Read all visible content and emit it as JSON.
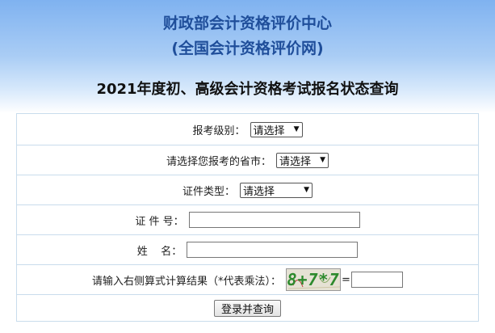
{
  "header": {
    "title_line1": "财政部会计资格评价中心",
    "title_line2": "(全国会计资格评价网)",
    "subtitle": "2021年度初、高级会计资格考试报名状态查询"
  },
  "form": {
    "level": {
      "label": "报考级别：",
      "selected": "请选择"
    },
    "province": {
      "label": "请选择您报考的省市：",
      "selected": "请选择"
    },
    "id_type": {
      "label": "证件类型：",
      "selected": "请选择"
    },
    "id_number": {
      "label": "证 件 号：",
      "value": ""
    },
    "name": {
      "label": "姓    名：",
      "value": ""
    },
    "captcha": {
      "label": "请输入右侧算式计算结果（*代表乘法）：",
      "expression": "8+7*7",
      "equals": "=",
      "value": ""
    },
    "submit_label": "登录并查询"
  },
  "colors": {
    "title": "#1f4e9a",
    "captcha_text": "#2d8a2d",
    "border": "#c9dcec"
  }
}
